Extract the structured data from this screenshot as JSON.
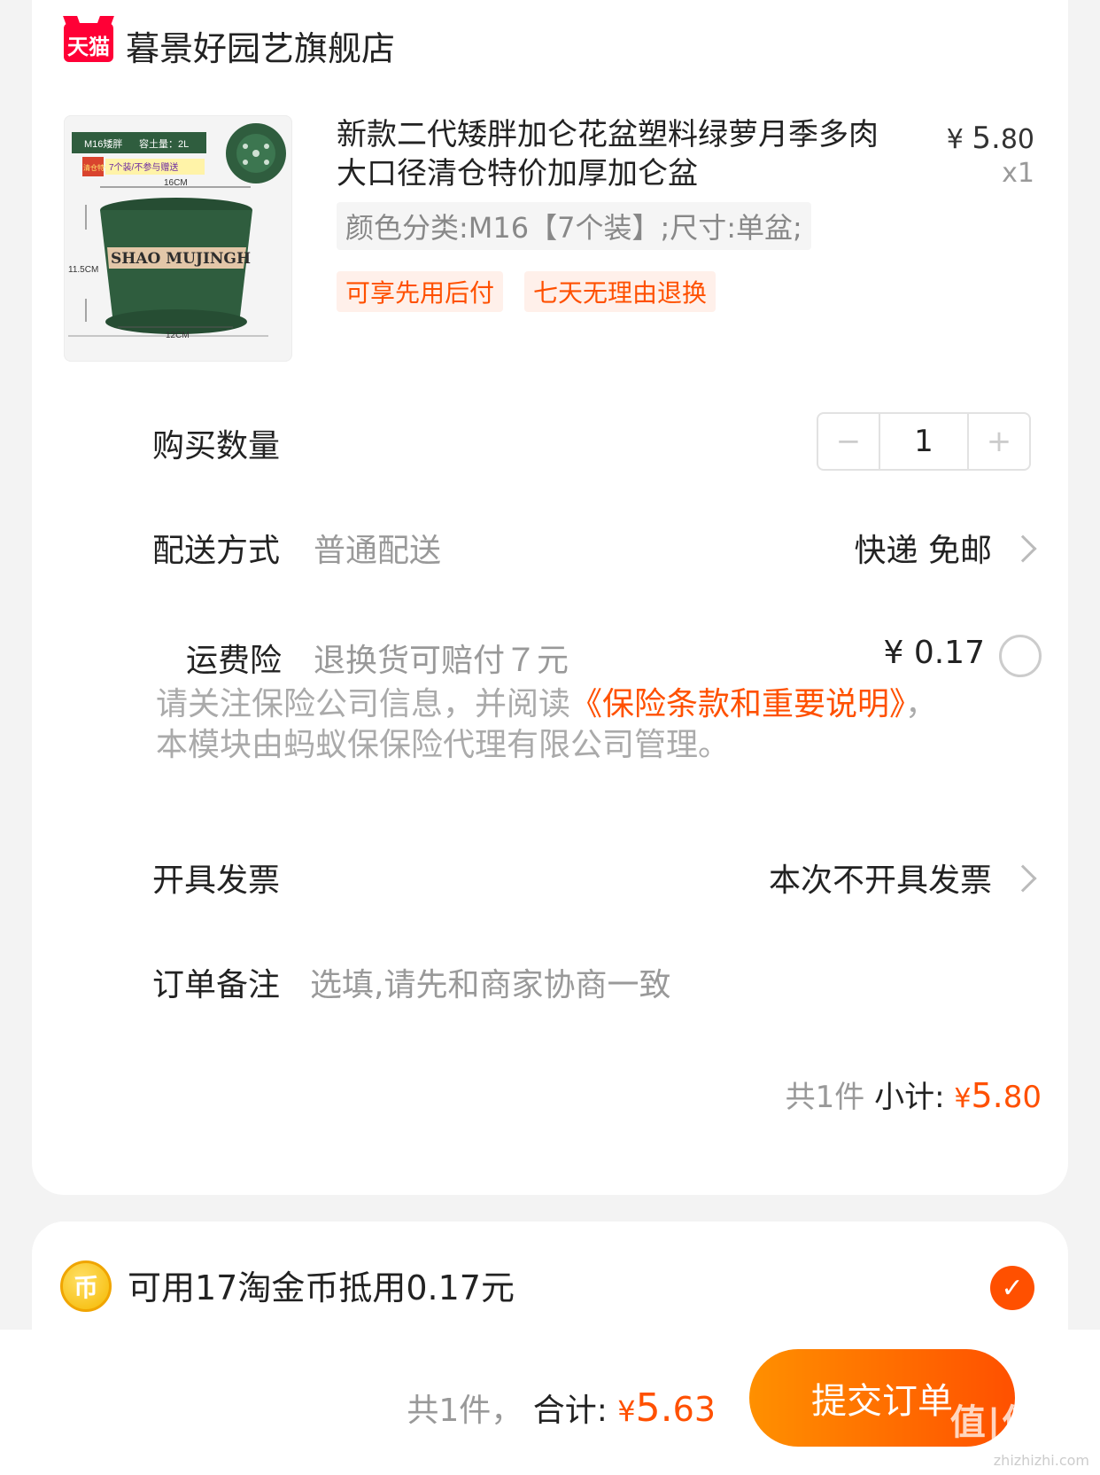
{
  "shop": {
    "badge": "天猫",
    "name": "暮景好园艺旗舰店"
  },
  "product": {
    "title": "新款二代矮胖加仑花盆塑料绿萝月季多肉大口径清仓特价加厚加仑盆",
    "price_symbol": "¥",
    "price_int": "5.",
    "price_dec": "80",
    "qty": "x1",
    "sku": "颜色分类:M16【7个装】;尺寸:单盆;",
    "tags": [
      "可享先用后付",
      "七天无理由退换"
    ],
    "image": {
      "model": "M16矮胖",
      "capacity": "容土量：2L",
      "promo_l": "清仓特价",
      "promo": "7个装/不参与赠送",
      "width": "16CM",
      "height": "11.5CM",
      "base": "12CM",
      "brand": "SHAO MUJINGH"
    }
  },
  "quantity": {
    "label": "购买数量",
    "minus": "−",
    "value": "1",
    "plus": "+"
  },
  "delivery": {
    "label": "配送方式",
    "type": "普通配送",
    "value": "快递 免邮"
  },
  "insurance": {
    "label": "运费险",
    "desc": "退换货可赔付７元",
    "price": "¥ 0.17"
  },
  "notice": {
    "prefix": "请关注保险公司信息，并阅读",
    "link": "《保险条款和重要说明》",
    "suffix": "，本模块由蚂蚁保保险代理有限公司管理。"
  },
  "invoice": {
    "label": "开具发票",
    "value": "本次不开具发票"
  },
  "remark": {
    "label": "订单备注",
    "placeholder": "选填,请先和商家协商一致"
  },
  "subtotal": {
    "count": "共1件",
    "label": "小计:",
    "symbol": "¥",
    "int": "5.",
    "dec": "80"
  },
  "coin": {
    "icon_glyph": "币",
    "text": "可用17淘金币抵用0.17元",
    "check": "✓"
  },
  "footer": {
    "count": "共1件，",
    "label": "合计:",
    "symbol": "¥",
    "int": "5.",
    "dec": "63",
    "submit": "提交订单"
  },
  "watermark": {
    "text": "值|值|值",
    "url": "zhizhizhi.com"
  },
  "colors": {
    "accent": "#ff5000",
    "tmall_red": "#ff0036",
    "pot_green": "#2f5d3e"
  }
}
